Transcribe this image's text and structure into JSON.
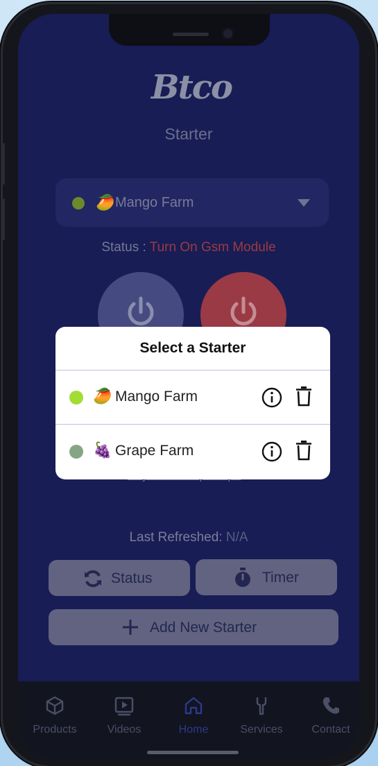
{
  "header": {
    "logo_text": "Btco",
    "title": "Starter"
  },
  "selector": {
    "emoji": "🥭",
    "label": "Mango Farm",
    "status_color": "#6a8a2c"
  },
  "status": {
    "label": "Status :",
    "value": "Turn On Gsm Module"
  },
  "power_buttons": [
    {
      "name": "power-on",
      "icon": "power-icon"
    },
    {
      "name": "power-off",
      "icon": "power-icon"
    }
  ],
  "adjust_link": "Adjust OL Trip Amps",
  "last_refreshed": {
    "label": "Last Refreshed:",
    "value": "N/A"
  },
  "actions": {
    "status_label": "Status",
    "timer_label": "Timer",
    "add_label": "Add New Starter"
  },
  "tabs": [
    {
      "label": "Products",
      "icon": "cube-icon"
    },
    {
      "label": "Videos",
      "icon": "play-icon"
    },
    {
      "label": "Home",
      "icon": "home-icon",
      "active": true
    },
    {
      "label": "Services",
      "icon": "wrench-icon"
    },
    {
      "label": "Contact",
      "icon": "phone-icon"
    }
  ],
  "modal": {
    "title": "Select a Starter",
    "items": [
      {
        "emoji": "🥭",
        "label": "Mango Farm",
        "status_color": "#a4dc36"
      },
      {
        "emoji": "🍇",
        "label": "Grape Farm",
        "status_color": "#86a584"
      }
    ]
  }
}
